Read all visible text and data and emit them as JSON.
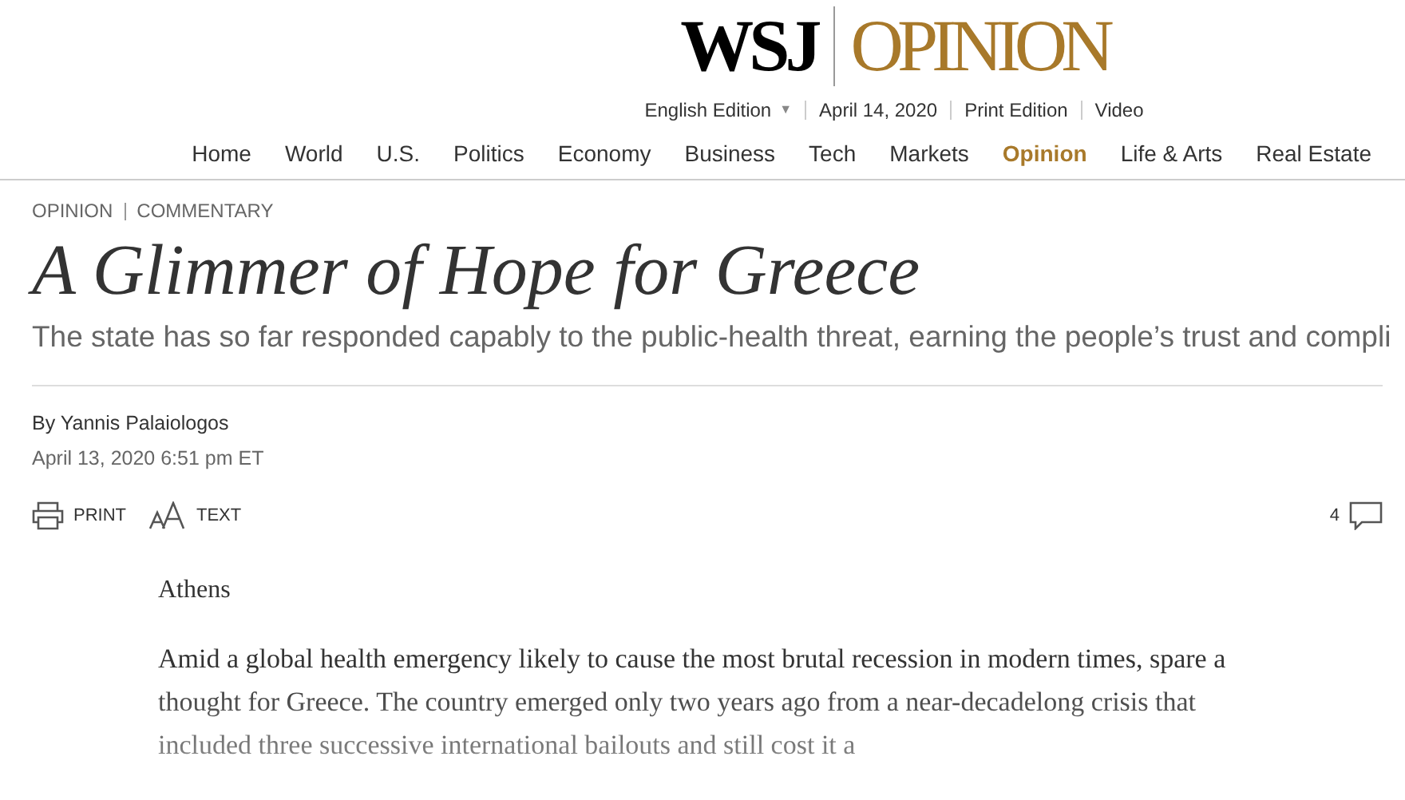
{
  "masthead": {
    "logo": "WSJ",
    "section": "OPINION"
  },
  "edition_bar": [
    {
      "label": "English Edition",
      "kind": "dropdown",
      "caret": "▼"
    },
    {
      "label": "April 14, 2020",
      "kind": "text"
    },
    {
      "label": "Print Edition",
      "kind": "link"
    },
    {
      "label": "Video",
      "kind": "link"
    }
  ],
  "nav": [
    {
      "label": "Home",
      "selected": false
    },
    {
      "label": "World",
      "selected": false
    },
    {
      "label": "U.S.",
      "selected": false
    },
    {
      "label": "Politics",
      "selected": false
    },
    {
      "label": "Economy",
      "selected": false
    },
    {
      "label": "Business",
      "selected": false
    },
    {
      "label": "Tech",
      "selected": false
    },
    {
      "label": "Markets",
      "selected": false
    },
    {
      "label": "Opinion",
      "selected": true
    },
    {
      "label": "Life & Arts",
      "selected": false
    },
    {
      "label": "Real Estate",
      "selected": false
    }
  ],
  "article": {
    "flags": [
      "OPINION",
      "COMMENTARY"
    ],
    "headline": "A Glimmer of Hope for Greece",
    "dek": "The state has so far responded capably to the public-health threat, earning the people’s trust and compli",
    "byline": "By Yannis Palaiologos",
    "timestamp": "April 13, 2020 6:51 pm ET",
    "tools": [
      {
        "kind": "print",
        "label": "PRINT"
      },
      {
        "kind": "text",
        "label": "TEXT"
      }
    ],
    "comment_count": "4",
    "dateline": "Athens",
    "body": "Amid a global health emergency likely to cause the most brutal recession in modern times, spare a thought for Greece. The country emerged only two years ago from a near-decadelong crisis that included three successive international bailouts and still cost it a"
  }
}
